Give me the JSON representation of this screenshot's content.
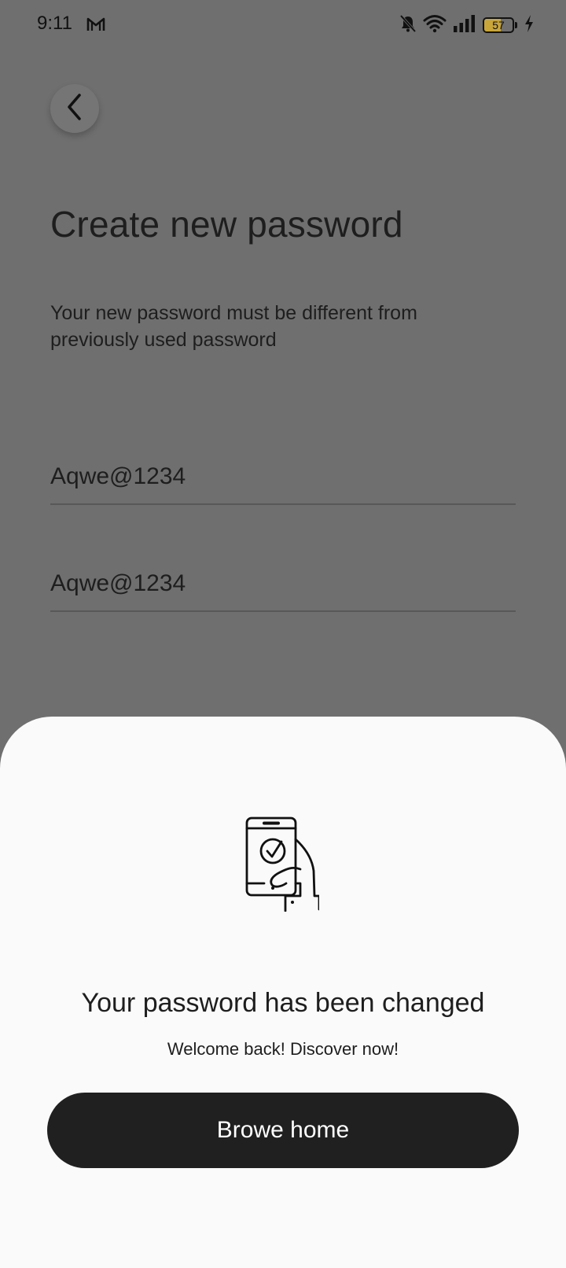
{
  "status_bar": {
    "time": "9:11",
    "battery_level": "57",
    "battery_fraction": 0.57,
    "icons": [
      "gmail-icon",
      "notifications-muted-icon",
      "wifi-icon",
      "signal-icon",
      "battery-icon",
      "charging-icon"
    ]
  },
  "header": {
    "back_icon": "chevron-left-icon"
  },
  "form": {
    "title": "Create new password",
    "subtitle": "Your new password must be different from previously used password",
    "new_password_value": "Aqwe@1234",
    "confirm_password_value": "Aqwe@1234"
  },
  "success_sheet": {
    "illustration_icon": "phone-check-hand-icon",
    "title": "Your password has been changed",
    "subtitle": "Welcome back! Discover now!",
    "button_label": "Browe home"
  },
  "colors": {
    "scrim_background": "#6f6f6f",
    "sheet_background": "#fafafa",
    "button_background": "#202020",
    "button_text": "#ffffff",
    "battery_fill": "#c9a63a"
  }
}
